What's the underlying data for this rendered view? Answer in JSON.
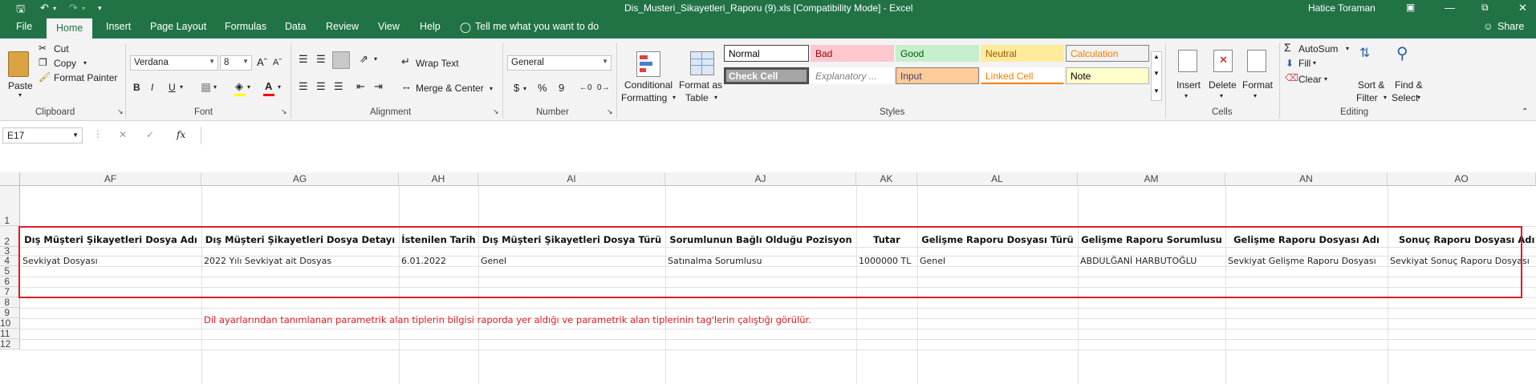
{
  "titlebar": {
    "title": "Dis_Musteri_Sikayetleri_Raporu (9).xls  [Compatibility Mode]  -  Excel",
    "user": "Hatice Toraman"
  },
  "tabs": [
    "File",
    "Home",
    "Insert",
    "Page Layout",
    "Formulas",
    "Data",
    "Review",
    "View",
    "Help"
  ],
  "tell_me": "Tell me what you want to do",
  "share": "Share",
  "ribbon": {
    "clipboard": {
      "paste": "Paste",
      "cut": "Cut",
      "copy": "Copy",
      "format_painter": "Format Painter",
      "group": "Clipboard"
    },
    "font": {
      "name": "Verdana",
      "size": "8",
      "group": "Font",
      "bold": "B",
      "italic": "I",
      "underline": "U",
      "font_color": "#ff0000",
      "fill_color": "#ffff00"
    },
    "alignment": {
      "wrap_text": "Wrap Text",
      "merge_center": "Merge & Center",
      "group": "Alignment"
    },
    "number": {
      "format": "General",
      "currency": "$",
      "percent": "%",
      "comma": "9",
      "group": "Number"
    },
    "styles": {
      "conditional": [
        "Conditional",
        "Formatting"
      ],
      "format_as": [
        "Format as",
        "Table"
      ],
      "cells": [
        {
          "label": "Normal",
          "bg": "#ffffff",
          "fg": "#000000",
          "border": "#999999"
        },
        {
          "label": "Bad",
          "bg": "#ffc7ce",
          "fg": "#9c0006",
          "border": "#ffc7ce"
        },
        {
          "label": "Good",
          "bg": "#c6efce",
          "fg": "#006100",
          "border": "#c6efce"
        },
        {
          "label": "Neutral",
          "bg": "#ffeb9c",
          "fg": "#9c5700",
          "border": "#ffeb9c"
        },
        {
          "label": "Calculation",
          "bg": "#f2f2f2",
          "fg": "#fa7d00",
          "border": "#7f7f7f"
        },
        {
          "label": "Check Cell",
          "bg": "#a5a5a5",
          "fg": "#ffffff",
          "border": "#3f3f3f"
        },
        {
          "label": "Explanatory ...",
          "bg": "#ffffff",
          "fg": "#7f7f7f",
          "border": "#ffffff"
        },
        {
          "label": "Input",
          "bg": "#ffcc99",
          "fg": "#3f3f76",
          "border": "#7f7f7f"
        },
        {
          "label": "Linked Cell",
          "bg": "#ffffff",
          "fg": "#fa7d00",
          "border": "#ffffff"
        },
        {
          "label": "Note",
          "bg": "#ffffcc",
          "fg": "#000000",
          "border": "#b2b2b2"
        }
      ],
      "group": "Styles"
    },
    "cells": {
      "insert": "Insert",
      "delete": "Delete",
      "format": "Format",
      "group": "Cells"
    },
    "editing": {
      "autosum": "AutoSum",
      "fill": "Fill",
      "clear": "Clear",
      "sort": [
        "Sort &",
        "Filter"
      ],
      "find": [
        "Find &",
        "Select"
      ],
      "group": "Editing"
    }
  },
  "formula_bar": {
    "name_box": "E17",
    "fx": "fx",
    "value": ""
  },
  "sheet": {
    "columns": [
      "AF",
      "AG",
      "AH",
      "AI",
      "AJ",
      "AK",
      "AL",
      "AM",
      "AN",
      "AO"
    ],
    "rows": [
      "1",
      "2",
      "3",
      "4",
      "5",
      "6",
      "7",
      "8",
      "9",
      "10",
      "11",
      "12"
    ],
    "headers": [
      "Dış Müşteri Şikayetleri Dosya Adı",
      "Dış Müşteri Şikayetleri Dosya Detayı",
      "İstenilen Tarih",
      "Dış Müşteri Şikayetleri Dosya Türü",
      "Sorumlunun Bağlı Olduğu Pozisyon",
      "Tutar",
      "Gelişme Raporu Dosyası Türü",
      "Gelişme Raporu Sorumlusu",
      "Gelişme Raporu Dosyası Adı",
      "Sonuç Raporu Dosyası Adı"
    ],
    "row3": [
      "Sevkiyat Dosyası",
      "2022 Yılı Sevkiyat ait Dosyas",
      "6.01.2022",
      "Genel",
      "Satınalma Sorumlusu",
      "1000000 TL",
      "Genel",
      "ABDULĞANİ HARBUTOĞLU",
      "Sevkiyat Gelişme Raporu Dosyası",
      "Sevkiyat Sonuç Raporu Dosyası"
    ],
    "note": "Dil ayarlarından tanımlanan parametrik alan tiplerin bilgisi raporda yer aldığı ve parametrik alan tiplerinin tag'lerin çalıştığı görülür."
  }
}
